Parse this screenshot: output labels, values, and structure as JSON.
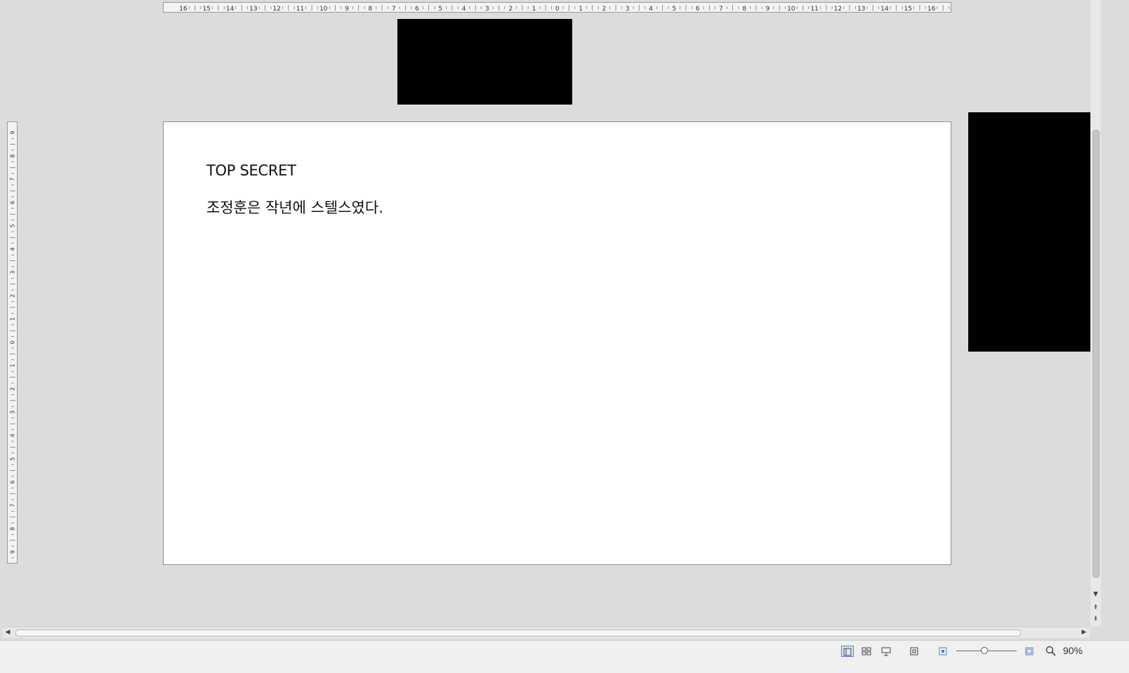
{
  "rulers": {
    "horizontal_labels": [
      "16",
      "15",
      "14",
      "13",
      "12",
      "11",
      "10",
      "9",
      "8",
      "7",
      "6",
      "5",
      "4",
      "3",
      "2",
      "1",
      "0",
      "1",
      "2",
      "3",
      "4",
      "5",
      "6",
      "7",
      "8",
      "9",
      "10",
      "11",
      "12",
      "13",
      "14",
      "15",
      "16"
    ],
    "vertical_labels": [
      "9",
      "8",
      "7",
      "6",
      "5",
      "4",
      "3",
      "2",
      "1",
      "0",
      "1",
      "2",
      "3",
      "4",
      "5",
      "6",
      "7",
      "8",
      "9"
    ]
  },
  "slide": {
    "title": "TOP SECRET",
    "body": "조정훈은 작년에 스텔스였다."
  },
  "statusbar": {
    "zoom_label": "90%",
    "icons": [
      "normal-view-icon",
      "slide-sorter-icon",
      "reading-view-icon",
      "fit-slide-icon",
      "zoom-out-icon",
      "zoom-fit-icon",
      "zoom-icon"
    ]
  },
  "colors": {
    "background": "#dcdcdc",
    "slide": "#ffffff",
    "redaction": "#000000"
  }
}
